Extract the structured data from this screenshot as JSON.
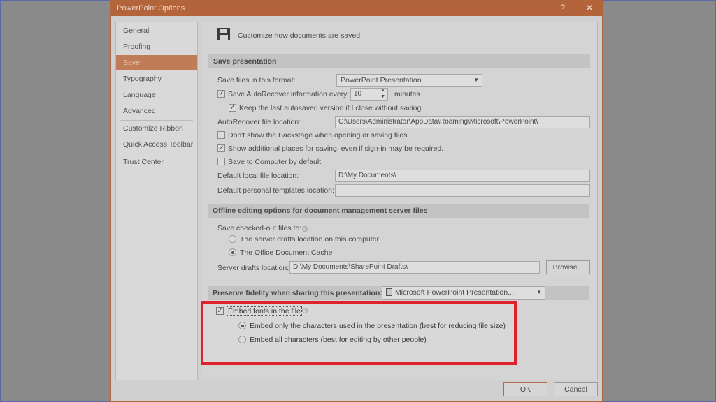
{
  "dialog": {
    "title": "PowerPoint Options",
    "help": "?",
    "close": "✕"
  },
  "nav": {
    "items": [
      "General",
      "Proofing",
      "Save",
      "Typography",
      "Language",
      "Advanced",
      "Customize Ribbon",
      "Quick Access Toolbar",
      "Trust Center"
    ],
    "selected": "Save"
  },
  "header": {
    "text": "Customize how documents are saved."
  },
  "save_presentation": {
    "title": "Save presentation",
    "format_label": "Save files in this format:",
    "format_value": "PowerPoint Presentation",
    "autorecover_label": "Save AutoRecover information every",
    "autorecover_minutes": "10",
    "minutes_label": "minutes",
    "keep_last_label": "Keep the last autosaved version if I close without saving",
    "autorecover_location_label": "AutoRecover file location:",
    "autorecover_location_value": "C:\\Users\\Administrator\\AppData\\Roaming\\Microsoft\\PowerPoint\\",
    "no_backstage_label": "Don't show the Backstage when opening or saving files",
    "additional_places_label": "Show additional places for saving, even if sign-in may be required.",
    "save_to_computer_label": "Save to Computer by default",
    "default_local_label": "Default local file location:",
    "default_local_value": "D:\\My Documents\\",
    "default_templates_label": "Default personal templates location:",
    "default_templates_value": ""
  },
  "offline": {
    "title": "Offline editing options for document management server files",
    "save_checked_out_label": "Save checked-out files to:",
    "server_drafts_option": "The server drafts location on this computer",
    "office_cache_option": "The Office Document Cache",
    "server_drafts_label": "Server drafts location:",
    "server_drafts_value": "D:\\My Documents\\SharePoint Drafts\\",
    "browse_label": "Browse..."
  },
  "fidelity": {
    "title": "Preserve fidelity when sharing this presentation:",
    "presentation_value": "Microsoft PowerPoint Presentation....",
    "embed_fonts_label": "Embed fonts in the file",
    "embed_only_option": "Embed only the characters used in the presentation (best for reducing file size)",
    "embed_all_option": "Embed all characters (best for editing by other people)"
  },
  "footer": {
    "ok_label": "OK",
    "cancel_label": "Cancel"
  },
  "colors": {
    "accent": "#b4643a",
    "highlight": "#e0202a"
  }
}
